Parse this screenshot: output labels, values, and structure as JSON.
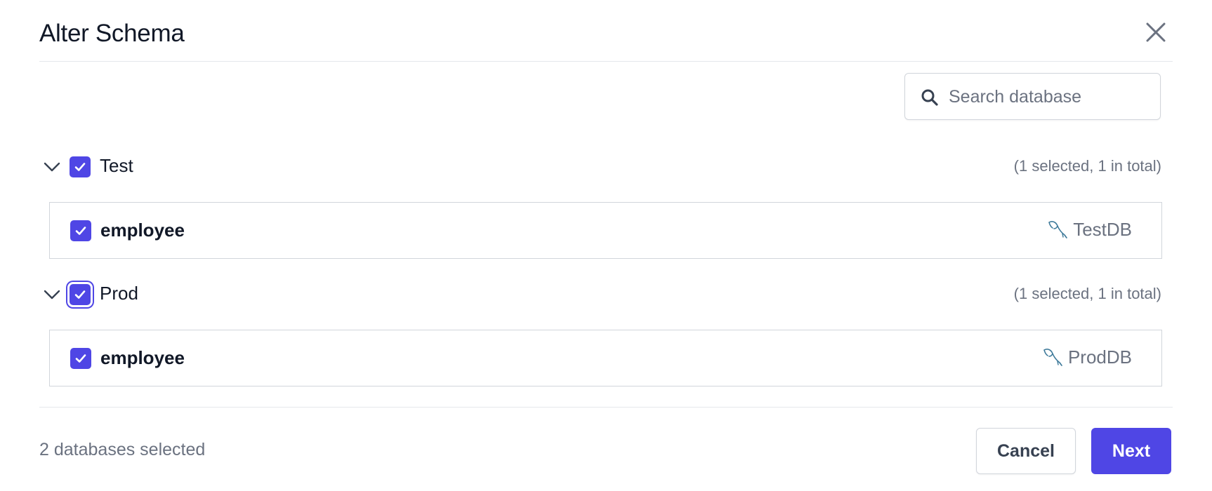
{
  "dialog": {
    "title": "Alter Schema"
  },
  "search": {
    "placeholder": "Search database",
    "value": ""
  },
  "groups": [
    {
      "name": "Test",
      "checked": true,
      "count_text": "(1 selected, 1 in total)",
      "databases": [
        {
          "name": "employee",
          "checked": true,
          "environment": "TestDB",
          "engine_icon": "mysql-dolphin-icon"
        }
      ]
    },
    {
      "name": "Prod",
      "checked": true,
      "focused": true,
      "count_text": "(1 selected, 1 in total)",
      "databases": [
        {
          "name": "employee",
          "checked": true,
          "environment": "ProdDB",
          "engine_icon": "mysql-dolphin-icon"
        }
      ]
    }
  ],
  "footer": {
    "selection_text": "2 databases selected",
    "cancel_label": "Cancel",
    "next_label": "Next"
  },
  "colors": {
    "accent": "#4f46e5",
    "border": "#d1d5db",
    "muted_text": "#6b7280",
    "mysql_icon": "#3e7a9a"
  }
}
